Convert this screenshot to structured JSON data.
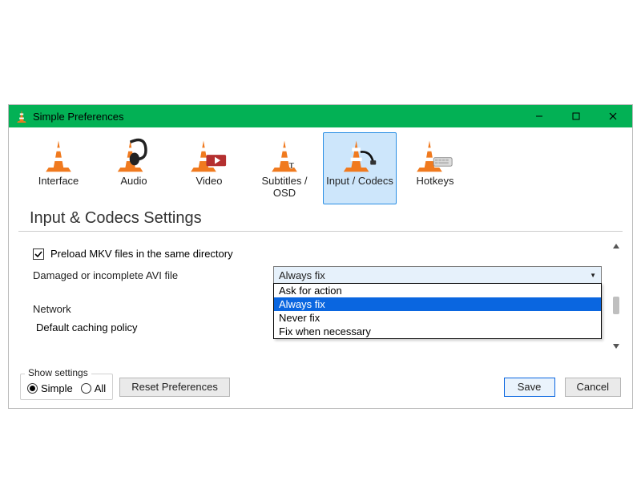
{
  "titlebar": {
    "title": "Simple Preferences"
  },
  "tabs": {
    "items": [
      {
        "label": "Interface"
      },
      {
        "label": "Audio"
      },
      {
        "label": "Video"
      },
      {
        "label": "Subtitles / OSD"
      },
      {
        "label": "Input / Codecs"
      },
      {
        "label": "Hotkeys"
      }
    ],
    "selected_index": 4
  },
  "heading": "Input & Codecs Settings",
  "preload": {
    "checked": true,
    "label": "Preload MKV files in the same directory"
  },
  "avi": {
    "label": "Damaged or incomplete AVI file",
    "selected": "Always fix",
    "options": [
      "Ask for action",
      "Always fix",
      "Never fix",
      "Fix when necessary"
    ],
    "highlighted_index": 1
  },
  "network_label": "Network",
  "caching_label": "Default caching policy",
  "show_settings": {
    "legend": "Show settings",
    "options": [
      {
        "label": "Simple",
        "checked": true
      },
      {
        "label": "All",
        "checked": false
      }
    ]
  },
  "buttons": {
    "reset": "Reset Preferences",
    "save": "Save",
    "cancel": "Cancel"
  }
}
